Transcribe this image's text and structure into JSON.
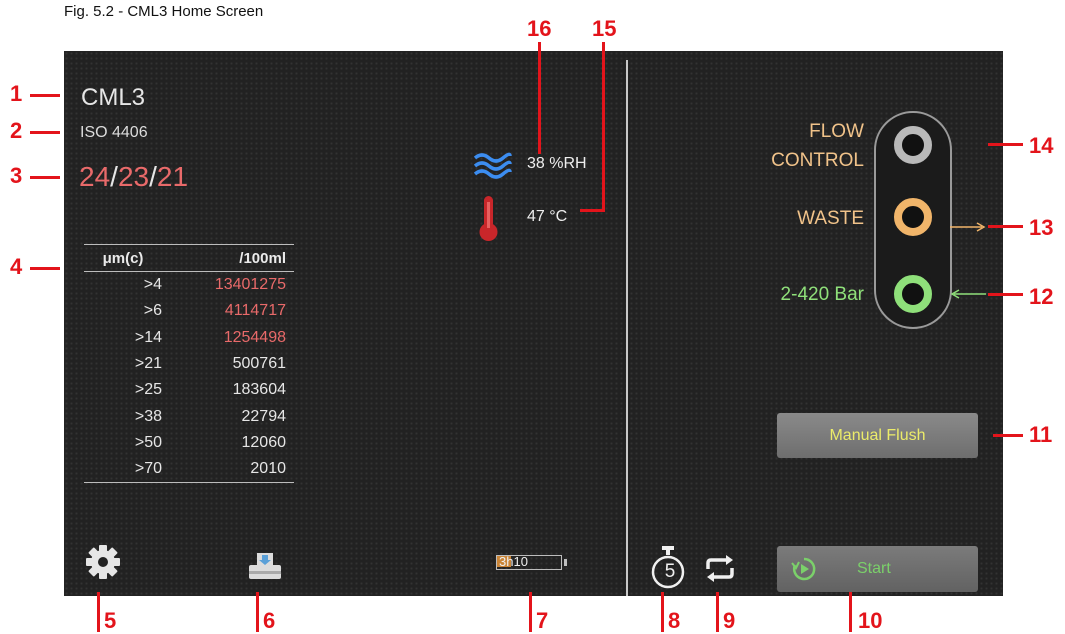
{
  "caption": "Fig. 5.2 - CML3 Home Screen",
  "device": {
    "title": "CML3",
    "standard": "ISO 4406"
  },
  "iso_code": {
    "a": "24",
    "b": "23",
    "c": "21",
    "sep": "/"
  },
  "counts_table": {
    "headers": [
      "μm(c)",
      "/100ml"
    ],
    "rows": [
      {
        "size": ">4",
        "count": "13401275",
        "highlight": true
      },
      {
        "size": ">6",
        "count": "4114717",
        "highlight": true
      },
      {
        "size": ">14",
        "count": "1254498",
        "highlight": true
      },
      {
        "size": ">21",
        "count": "500761",
        "highlight": false
      },
      {
        "size": ">25",
        "count": "183604",
        "highlight": false
      },
      {
        "size": ">38",
        "count": "22794",
        "highlight": false
      },
      {
        "size": ">50",
        "count": "12060",
        "highlight": false
      },
      {
        "size": ">70",
        "count": "2010",
        "highlight": false
      }
    ]
  },
  "sensors": {
    "humidity": "38 %RH",
    "temperature": "47 °C"
  },
  "status_lamps": {
    "flow_control": {
      "line1": "FLOW",
      "line2": "CONTROL",
      "ring_color": "#b9b9b9"
    },
    "waste": {
      "label": "WASTE",
      "ring_color": "#f1b56a"
    },
    "pressure": {
      "label": "2-420 Bar",
      "ring_color": "#8fe07a"
    }
  },
  "buttons": {
    "manual_flush": "Manual Flush",
    "start": "Start"
  },
  "battery": {
    "hours": "3h",
    "minutes": "10"
  },
  "timer": {
    "value": "5"
  },
  "colors": {
    "highlight": "#e96a6a",
    "lamp_label": "#f1c38a",
    "pressure_label": "#8fe07a",
    "callout": "#e3141b",
    "flush_text": "#ecec6a"
  },
  "icons": [
    "waves-icon",
    "thermometer-icon",
    "gear-icon",
    "print-icon",
    "battery-icon",
    "stopwatch-icon",
    "repeat-icon",
    "play-circle-icon"
  ],
  "callouts": [
    "1",
    "2",
    "3",
    "4",
    "5",
    "6",
    "7",
    "8",
    "9",
    "10",
    "11",
    "12",
    "13",
    "14",
    "15",
    "16"
  ]
}
